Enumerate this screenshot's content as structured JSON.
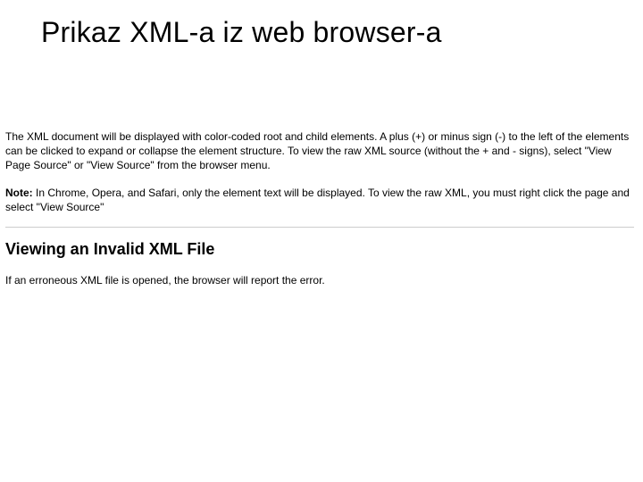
{
  "title": "Prikaz XML-a iz web browser-a",
  "paragraph1": "The XML document will be displayed with color-coded root and child elements. A plus (+) or minus sign (-) to the left of the elements can be clicked to expand or collapse the element structure. To view the raw XML source (without the + and - signs), select \"View Page Source\" or \"View Source\" from the browser menu.",
  "note_label": "Note:",
  "note_text": " In Chrome, Opera, and Safari, only the element text will be displayed. To view the raw XML, you must right click the page and select \"View Source\"",
  "section_heading": "Viewing an Invalid XML File",
  "paragraph2": "If an erroneous XML file is opened, the browser will report the error."
}
